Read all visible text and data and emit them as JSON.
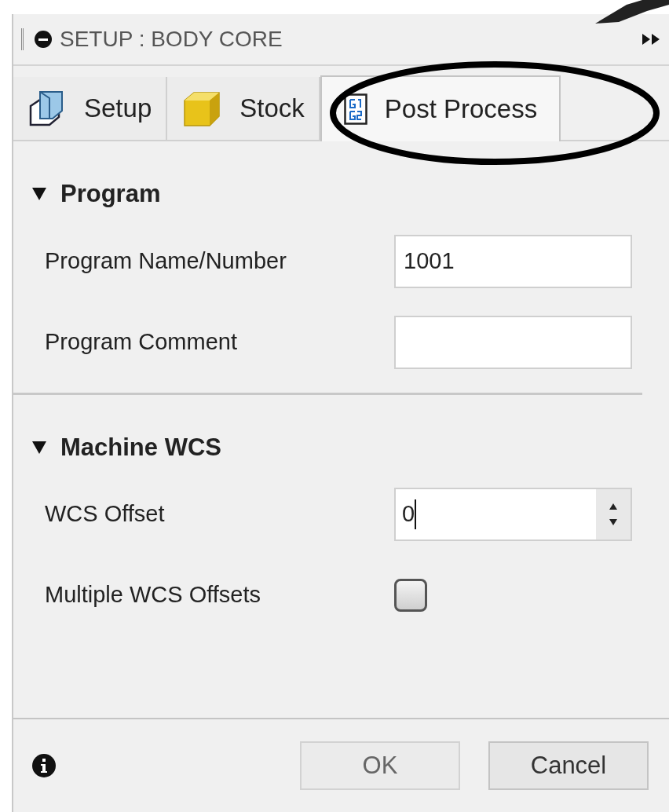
{
  "panel": {
    "title": "SETUP : BODY CORE"
  },
  "tabs": [
    {
      "kind": "setup",
      "label": "Setup",
      "selected": false
    },
    {
      "kind": "stock",
      "label": "Stock",
      "selected": false
    },
    {
      "kind": "post",
      "label": "Post Process",
      "selected": true
    }
  ],
  "sections": [
    {
      "title": "Program",
      "expanded": true,
      "rows": [
        {
          "kind": "text",
          "label": "Program Name/Number",
          "value": "1001"
        },
        {
          "kind": "text",
          "label": "Program Comment"
        }
      ]
    },
    {
      "title": "Machine WCS",
      "expanded": true,
      "rows": [
        {
          "kind": "spinner",
          "label": "WCS Offset",
          "value": "0"
        },
        {
          "kind": "checkbox",
          "label": "Multiple WCS Offsets",
          "checked": false
        }
      ]
    }
  ],
  "buttons": [
    {
      "label": "OK",
      "disabled": true
    },
    {
      "label": "Cancel",
      "disabled": false
    }
  ]
}
